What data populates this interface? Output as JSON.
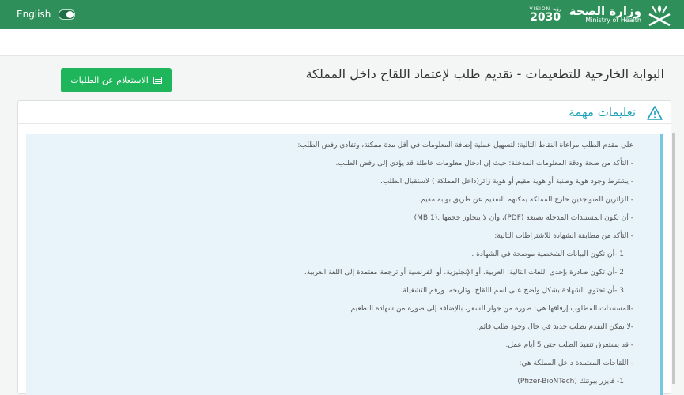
{
  "header": {
    "lang_toggle_label": "English",
    "vision_top": "VISION رؤية",
    "vision_number": "2030",
    "ministry_ar": "وزارة الصحة",
    "ministry_en": "Ministry of Health"
  },
  "page": {
    "title": "البوابة الخارجية للتطعيمات - تقديم طلب لإعتماد اللقاح داخل المملكة",
    "inquiry_button": "الاستعلام عن الطلبات"
  },
  "instructions": {
    "title": "تعليمات مهمة",
    "lines": [
      "على مقدم الطلب مراعاة النقاط التالية: لتسهيل عملية إضافة المعلومات في أقل مدة ممكنة، وتفادي رفض الطلب:",
      "- التأكد من صحة ودقة المعلومات المدخلة: حيث إن ادخال معلومات خاطئة قد يؤدي إلى رفض الطلب.",
      "- يشترط وجود هوية وطنية أو هوية مقيم أو هوية زائر(داخل المملكة ) لاستقبال الطلب.",
      "- الزائرين المتواجدين خارج المملكة يمكنهم التقديم عن طريق بوابة مقيم.",
      "- أن تكون المستندات المدخلة بصيغة (PDF)، وأن لا يتجاوز حجمها .(1 MB)",
      "- التأكد من مطابقة الشهادة للاشتراطات التالية:",
      "1 -أن تكون البيانات الشخصية موضحة في الشهادة .",
      "2 -أن تكون صادرة بإحدى اللغات التالية: العربية، أو الإنجليزية، أو الفرنسية أو ترجمة معتمدة إلى اللغة العربية.",
      "3 -أن تحتوي الشهادة بشكل واضح على اسم اللقاح، وتاريخه، ورقم التشغيلة.",
      "-المستندات المطلوب إرفاقها هي: صورة من جواز السفر، بالإضافة إلى صورة من شهادة التطعيم.",
      "-لا يمكن التقدم بطلب جديد في حال وجود طلب قائم.",
      "- قد يستغرق تنفيذ الطلب حتى 5 أيام عمل.",
      "- اللقاحات المعتمدة داخل المملكة هي:",
      "1- فايزر بيونتك (Pfizer-BioNTech)"
    ]
  }
}
